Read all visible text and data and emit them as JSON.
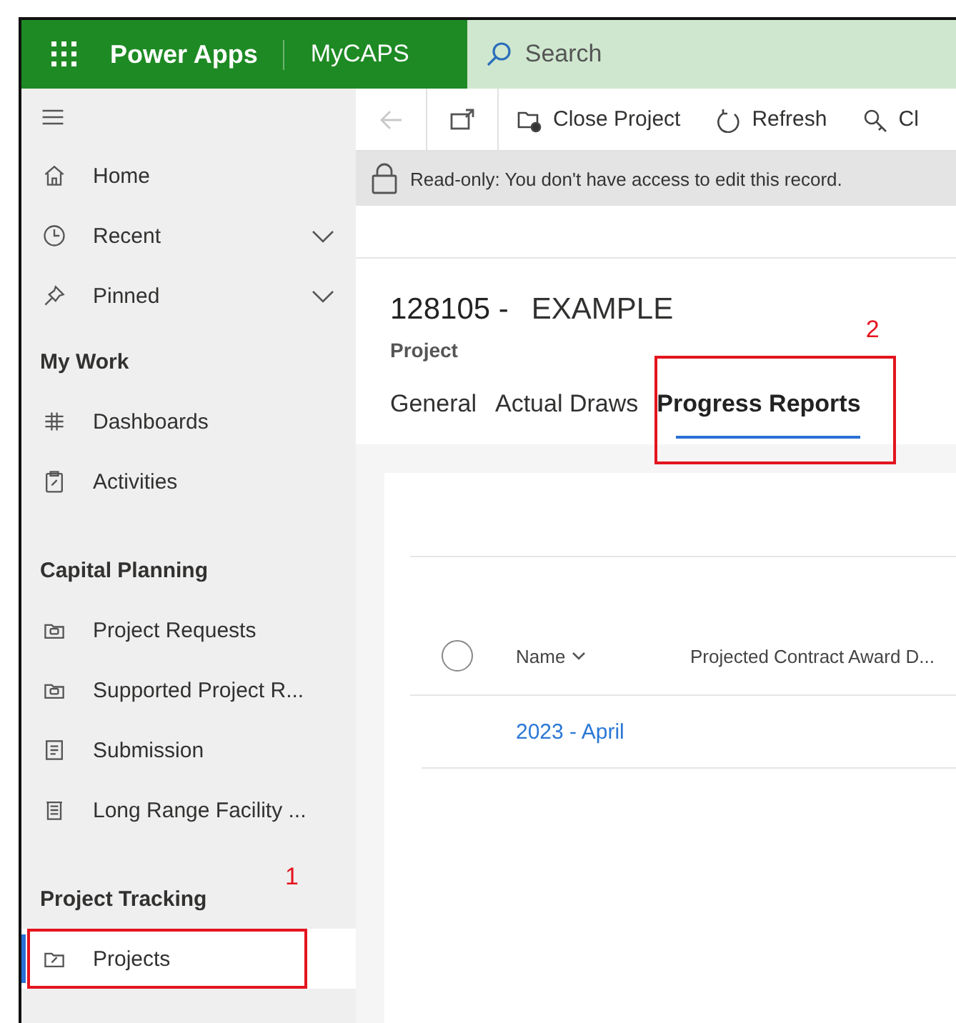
{
  "header": {
    "app_name": "Power Apps",
    "environment": "MyCAPS",
    "search": {
      "placeholder": "Search"
    }
  },
  "sidebar": {
    "sections": [
      {
        "items": [
          {
            "label": "Home",
            "selected": false
          },
          {
            "label": "Recent",
            "selected": false,
            "expanded": false
          },
          {
            "label": "Pinned",
            "selected": false,
            "expanded": false
          }
        ]
      },
      {
        "title": "My Work",
        "items": [
          {
            "label": "Dashboards",
            "selected": false
          },
          {
            "label": "Activities",
            "selected": false
          }
        ]
      },
      {
        "title": "Capital Planning",
        "items": [
          {
            "label": "Project Requests",
            "selected": false
          },
          {
            "label": "Supported Project R...",
            "selected": false
          },
          {
            "label": "Submission",
            "selected": false
          },
          {
            "label": "Long Range Facility ...",
            "selected": false
          }
        ]
      },
      {
        "title": "Project Tracking",
        "items": [
          {
            "label": "Projects",
            "selected": true,
            "callout": "1"
          }
        ]
      }
    ]
  },
  "toolbar": {
    "back_disabled": true,
    "buttons": [
      {
        "label": "Close Project"
      },
      {
        "label": "Refresh"
      },
      {
        "label": "Cl"
      }
    ]
  },
  "notice": "Read-only: You don't have access to edit this record.",
  "record": {
    "number": "128105 -",
    "name": "EXAMPLE",
    "entity": "Project"
  },
  "tabs": [
    {
      "label": "General",
      "selected": false
    },
    {
      "label": "Actual Draws",
      "selected": false
    },
    {
      "label": "Progress Reports",
      "selected": true,
      "callout": "2"
    }
  ],
  "grid": {
    "select_all": {
      "checked": false
    },
    "columns": [
      {
        "label": "Name",
        "sortable": true
      },
      {
        "label": "Projected Contract Award D..."
      }
    ],
    "rows": [
      {
        "name": "2023 - April",
        "selected": false
      }
    ]
  }
}
